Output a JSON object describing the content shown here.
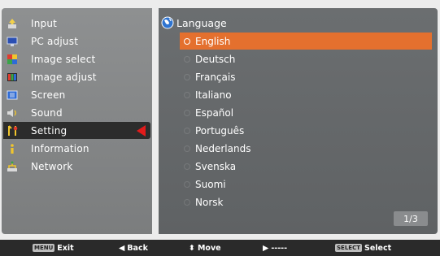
{
  "menu": {
    "items": [
      {
        "label": "Input",
        "icon": "input-icon"
      },
      {
        "label": "PC adjust",
        "icon": "monitor-icon"
      },
      {
        "label": "Image select",
        "icon": "image-select-icon"
      },
      {
        "label": "Image adjust",
        "icon": "image-adjust-icon"
      },
      {
        "label": "Screen",
        "icon": "screen-icon"
      },
      {
        "label": "Sound",
        "icon": "speaker-icon"
      },
      {
        "label": "Setting",
        "icon": "setting-icon"
      },
      {
        "label": "Information",
        "icon": "info-icon"
      },
      {
        "label": "Network",
        "icon": "network-icon"
      }
    ],
    "selected_index": 6
  },
  "language_panel": {
    "title": "Language",
    "title_icon": "globe-icon",
    "options": [
      "English",
      "Deutsch",
      "Français",
      "Italiano",
      "Español",
      "Português",
      "Nederlands",
      "Svenska",
      "Suomi",
      "Norsk"
    ],
    "selected_index": 0,
    "page_indicator": "1/3"
  },
  "footer": {
    "exit_button": "MENU",
    "exit_label": "Exit",
    "back_label": "Back",
    "move_label": "Move",
    "next_label": "-----",
    "select_button": "SELECT",
    "select_label": "Select"
  },
  "colors": {
    "highlight": "#e4702e",
    "selection_arrow": "#e21b1b",
    "selected_menu_bg": "#2c2c2c"
  }
}
